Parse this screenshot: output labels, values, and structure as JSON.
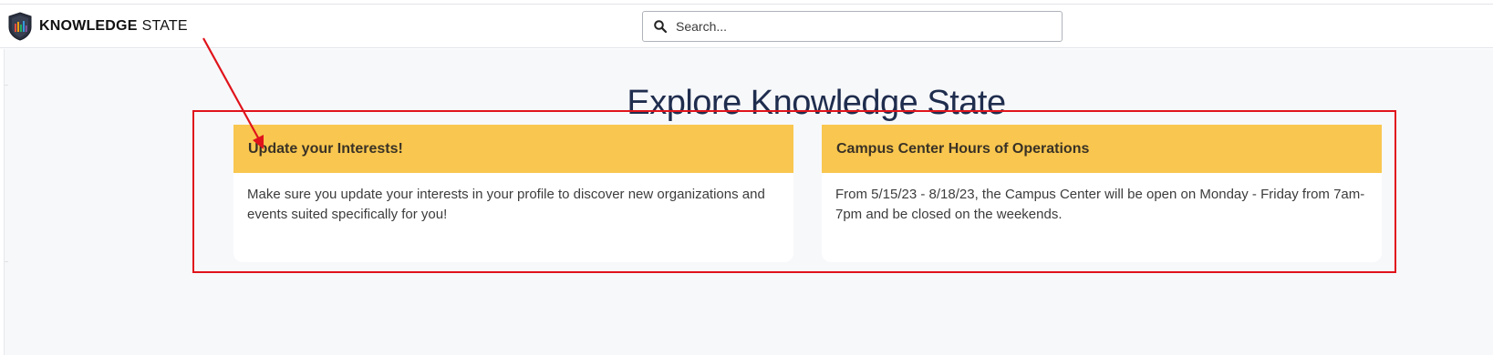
{
  "brand": {
    "name_bold": "KNOWLEDGE",
    "name_regular": "STATE"
  },
  "search": {
    "placeholder": "Search..."
  },
  "main": {
    "title": "Explore Knowledge State",
    "cards": [
      {
        "title": "Update your Interests!",
        "body": "Make sure you update your interests in your profile to discover new organizations and events suited specifically for you!"
      },
      {
        "title": "Campus Center Hours of Operations",
        "body": "From 5/15/23 - 8/18/23, the Campus Center will be open on Monday - Friday from 7am-7pm and be closed on the weekends."
      }
    ]
  },
  "colors": {
    "card_header": "#f9c74f",
    "title_text": "#1f2d4e",
    "annotation": "#e0131b",
    "background": "#f7f8fa"
  }
}
